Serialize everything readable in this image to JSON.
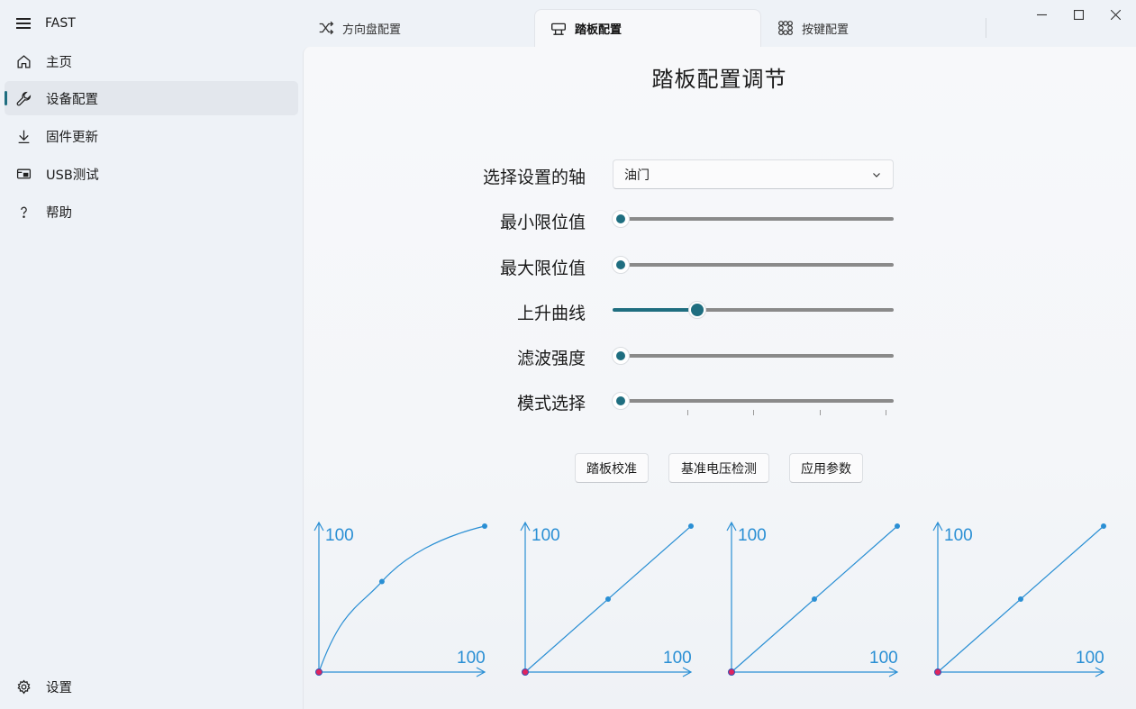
{
  "app": {
    "title": "FAST"
  },
  "sidebar": {
    "items": [
      {
        "label": "主页",
        "icon": "home-icon"
      },
      {
        "label": "设备配置",
        "icon": "wrench-icon",
        "active": true
      },
      {
        "label": "固件更新",
        "icon": "download-icon"
      },
      {
        "label": "USB测试",
        "icon": "usb-device-icon"
      },
      {
        "label": "帮助",
        "icon": "question-icon"
      }
    ],
    "settings_label": "设置"
  },
  "tabs": [
    {
      "label": "方向盘配置",
      "icon": "shuffle-icon"
    },
    {
      "label": "踏板配置",
      "icon": "pedal-icon",
      "active": true
    },
    {
      "label": "按键配置",
      "icon": "button-grid-icon"
    }
  ],
  "page": {
    "title": "踏板配置调节",
    "axis_label": "选择设置的轴",
    "axis_value": "油门",
    "sliders": [
      {
        "label": "最小限位值",
        "value": 0
      },
      {
        "label": "最大限位值",
        "value": 0
      },
      {
        "label": "上升曲线",
        "value": 0.28
      },
      {
        "label": "滤波强度",
        "value": 0
      },
      {
        "label": "模式选择",
        "value": 0,
        "ticks": 4
      }
    ],
    "buttons": [
      "踏板校准",
      "基准电压检测",
      "应用参数"
    ]
  },
  "curves": [
    {
      "x_max_label": "100",
      "y_max_label": "100",
      "shape": "log"
    },
    {
      "x_max_label": "100",
      "y_max_label": "100",
      "shape": "linear"
    },
    {
      "x_max_label": "100",
      "y_max_label": "100",
      "shape": "linear"
    },
    {
      "x_max_label": "100",
      "y_max_label": "100",
      "shape": "linear"
    }
  ],
  "colors": {
    "accent": "#1f6e80",
    "curve": "#2a8fd4",
    "origin_point": "#e0245e"
  }
}
